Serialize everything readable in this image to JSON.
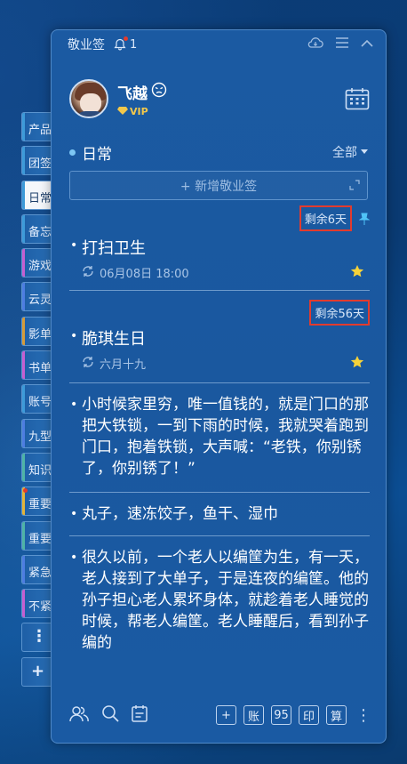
{
  "window": {
    "app_name": "敬业签",
    "notification_count": "1"
  },
  "profile": {
    "username": "飞越",
    "vip_label": "VIP"
  },
  "sidebar": {
    "tabs": [
      {
        "label": "产品",
        "color": "#3d9ad8",
        "active": false
      },
      {
        "label": "团签",
        "color": "#3d9ad8",
        "active": false
      },
      {
        "label": "日常",
        "color": "#3d9ad8",
        "active": true
      },
      {
        "label": "备忘",
        "color": "#3d9ad8",
        "active": false
      },
      {
        "label": "游戏",
        "color": "#c55fd0",
        "active": false
      },
      {
        "label": "云灵",
        "color": "#4d7de0",
        "active": false
      },
      {
        "label": "影单",
        "color": "#d49b3a",
        "active": false
      },
      {
        "label": "书单",
        "color": "#c55fd0",
        "active": false
      },
      {
        "label": "账号",
        "color": "#3d9ad8",
        "active": false
      },
      {
        "label": "九型",
        "color": "#4d7de0",
        "active": false
      },
      {
        "label": "知识",
        "color": "#4fb3a6",
        "active": false
      },
      {
        "label": "重要",
        "color": "#e2b43a",
        "active": false,
        "dot": true
      },
      {
        "label": "重要",
        "color": "#4fb3a6",
        "active": false
      },
      {
        "label": "紧急",
        "color": "#4d7de0",
        "active": false
      },
      {
        "label": "不紧",
        "color": "#c55fd0",
        "active": false
      }
    ],
    "more_label": "⋮",
    "add_label": "+"
  },
  "category": {
    "name": "日常",
    "filter": "全部"
  },
  "add_note": {
    "label": "+ 新增敬业签"
  },
  "notes": [
    {
      "remaining": "剩余6天",
      "title": "打扫卫生",
      "meta": "06月08日 18:00",
      "pinned": true,
      "starred": true
    },
    {
      "remaining": "剩余56天",
      "title": "脆琪生日",
      "meta": "六月十九",
      "pinned": false,
      "starred": true
    }
  ],
  "paragraphs": [
    "小时候家里穷，唯一值钱的，就是门口的那把大铁锁，一到下雨的时候，我就哭着跑到门口，抱着铁锁，大声喊：“老铁，你别锈了，你别锈了！”",
    "丸子，速冻饺子，鱼干、湿巾",
    "很久以前，一个老人以编筐为生，有一天，老人接到了大单子，于是连夜的编筐。他的孙子担心老人累坏身体，就趁着老人睡觉的时候，帮老人编筐。老人睡醒后，看到孙子编的"
  ],
  "bottombar": {
    "buttons": [
      "账",
      "95",
      "印",
      "算"
    ],
    "plus": "+"
  },
  "colors": {
    "panel_bg": "#1b5aa2",
    "highlight_box": "#e23b2e",
    "star": "#f6d23a",
    "pin": "#4fc3f7"
  }
}
